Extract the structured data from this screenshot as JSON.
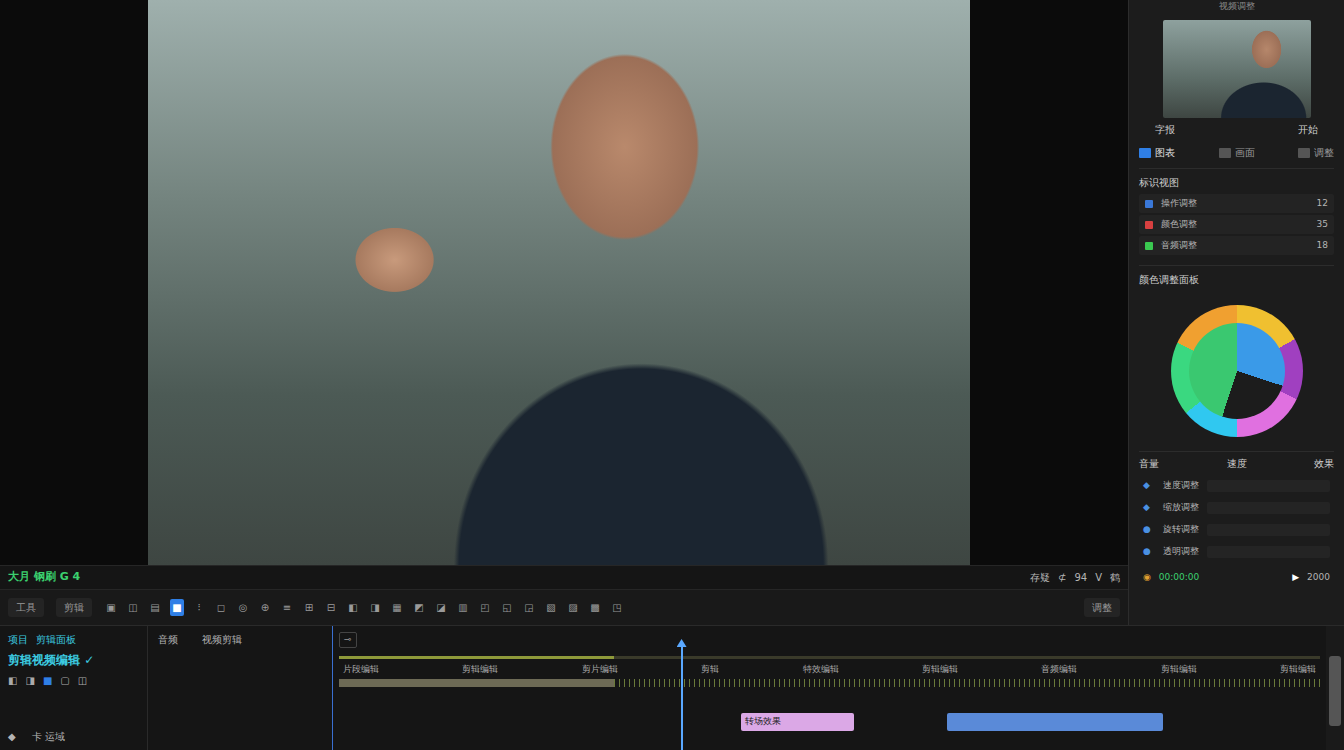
{
  "window": {
    "title": "视频调整"
  },
  "playback_bar": {
    "left_label": "大月 钢刷 G 4",
    "right_items": [
      "存疑",
      "⊄",
      "94",
      "Ⅴ",
      "鹤"
    ]
  },
  "toolbar": {
    "label": "工具",
    "segment": "剪辑",
    "buttons": [
      {
        "icon": "▣",
        "selected": false
      },
      {
        "icon": "◫",
        "selected": false
      },
      {
        "icon": "▤",
        "selected": false
      },
      {
        "icon": "■",
        "selected": true
      },
      {
        "icon": "⁝",
        "selected": false
      },
      {
        "icon": "◻",
        "selected": false
      },
      {
        "icon": "◎",
        "selected": false
      },
      {
        "icon": "⊕",
        "selected": false
      },
      {
        "icon": "≡",
        "selected": false
      },
      {
        "icon": "⊞",
        "selected": false
      },
      {
        "icon": "⊟",
        "selected": false
      },
      {
        "icon": "◧",
        "selected": false
      },
      {
        "icon": "◨",
        "selected": false
      },
      {
        "icon": "▦",
        "selected": false
      },
      {
        "icon": "◩",
        "selected": false
      },
      {
        "icon": "◪",
        "selected": false
      },
      {
        "icon": "▥",
        "selected": false
      },
      {
        "icon": "◰",
        "selected": false
      },
      {
        "icon": "◱",
        "selected": false
      },
      {
        "icon": "◲",
        "selected": false
      },
      {
        "icon": "▧",
        "selected": false
      },
      {
        "icon": "▨",
        "selected": false
      },
      {
        "icon": "▩",
        "selected": false
      },
      {
        "icon": "◳",
        "selected": false
      }
    ],
    "end_segment": "调整"
  },
  "panel": {
    "thumb_caption": [
      "字报",
      "开始"
    ],
    "view_tabs": [
      {
        "label": "图表",
        "selected": true
      },
      {
        "label": "画面",
        "selected": false
      },
      {
        "label": "调整",
        "selected": false
      }
    ],
    "list_title": "标识视图",
    "list": [
      {
        "name": "操作调整",
        "value": "12",
        "color": "#3a78d8"
      },
      {
        "name": "颜色调整",
        "value": "35",
        "color": "#d84040"
      },
      {
        "name": "音频调整",
        "value": "18",
        "color": "#3ac850"
      }
    ],
    "wheel_title": "颜色调整面板",
    "wheel": [
      {
        "color": "#f0c030",
        "level": 0.17
      },
      {
        "color": "#a040c0",
        "level": 0.15
      },
      {
        "color": "#e070e0",
        "level": 0.18
      },
      {
        "color": "#30c8f0",
        "level": 0.14
      },
      {
        "color": "#3ad880",
        "level": 0.18
      },
      {
        "color": "#f0a030",
        "level": 0.18
      }
    ],
    "wheel_inner": [
      {
        "color": "#3a9ae8",
        "level": 0.3
      },
      {
        "color": "#1c1c1c",
        "level": 0.25
      },
      {
        "color": "#3ac870",
        "level": 0.45
      }
    ],
    "props_header": [
      "音量",
      "速度",
      "效果"
    ],
    "props": [
      {
        "icon": "◆",
        "label": "速度调整"
      },
      {
        "icon": "◆",
        "label": "缩放调整"
      },
      {
        "icon": "●",
        "label": "旋转调整"
      },
      {
        "icon": "●",
        "label": "透明调整"
      }
    ],
    "footer": {
      "icon": "◉",
      "timecode": "00:00:00",
      "play": "▶",
      "value": "2000"
    }
  },
  "timeline": {
    "header": [
      "项目",
      "剪辑面板"
    ],
    "title": "剪辑视频编辑 ✓",
    "tools": [
      "◧",
      "◨",
      "■",
      "▢",
      "◫"
    ],
    "track_labels": [
      "音频",
      "视频剪辑"
    ],
    "side_icons": [
      "◆",
      "卡 运域"
    ],
    "top_icon": "⊸",
    "range": 0.28,
    "ruler": [
      "片段编辑",
      "剪辑编辑",
      "剪片编辑",
      "剪辑",
      "特效编辑",
      "剪辑编辑",
      "音频编辑",
      "剪辑编辑",
      "剪辑编辑"
    ],
    "playhead": 0.35,
    "clips": [
      {
        "label": "转场效果",
        "start": 0.41,
        "end": 0.525,
        "color": "#dba8e6"
      },
      {
        "label": "",
        "start": 0.62,
        "end": 0.84,
        "color": "#5a8ad8"
      }
    ]
  }
}
